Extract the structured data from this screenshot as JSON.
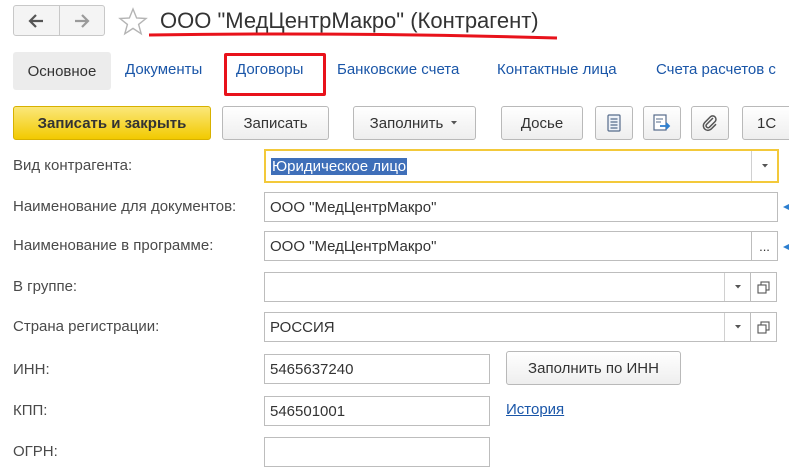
{
  "window": {
    "title": "ООО \"МедЦентрМакро\" (Контрагент)"
  },
  "tabs": [
    {
      "label": "Основное"
    },
    {
      "label": "Документы"
    },
    {
      "label": "Договоры"
    },
    {
      "label": "Банковские счета"
    },
    {
      "label": "Контактные лица"
    },
    {
      "label": "Счета расчетов с"
    }
  ],
  "toolbar": {
    "save_close": "Записать и закрыть",
    "save": "Записать",
    "fill": "Заполнить",
    "dossier": "Досье",
    "onec": "1С"
  },
  "form": {
    "kind_label": "Вид контрагента:",
    "kind_value": "Юридическое лицо",
    "doc_name_label": "Наименование для документов:",
    "doc_name_value": "ООО \"МедЦентрМакро\"",
    "prog_name_label": "Наименование в программе:",
    "prog_name_value": "ООО \"МедЦентрМакро\"",
    "prog_name_more": "...",
    "group_label": "В группе:",
    "group_value": "",
    "country_label": "Страна регистрации:",
    "country_value": "РОССИЯ",
    "inn_label": "ИНН:",
    "inn_value": "5465637240",
    "fill_by_inn": "Заполнить по ИНН",
    "kpp_label": "КПП:",
    "kpp_value": "546501001",
    "history_link": "История",
    "ogrn_label": "ОГРН:",
    "ogrn_value": ""
  },
  "colors": {
    "link": "#1a56a8",
    "primary_button": "#f2ca00",
    "highlight": "#e8121b",
    "selection": "#3f6fb9"
  }
}
